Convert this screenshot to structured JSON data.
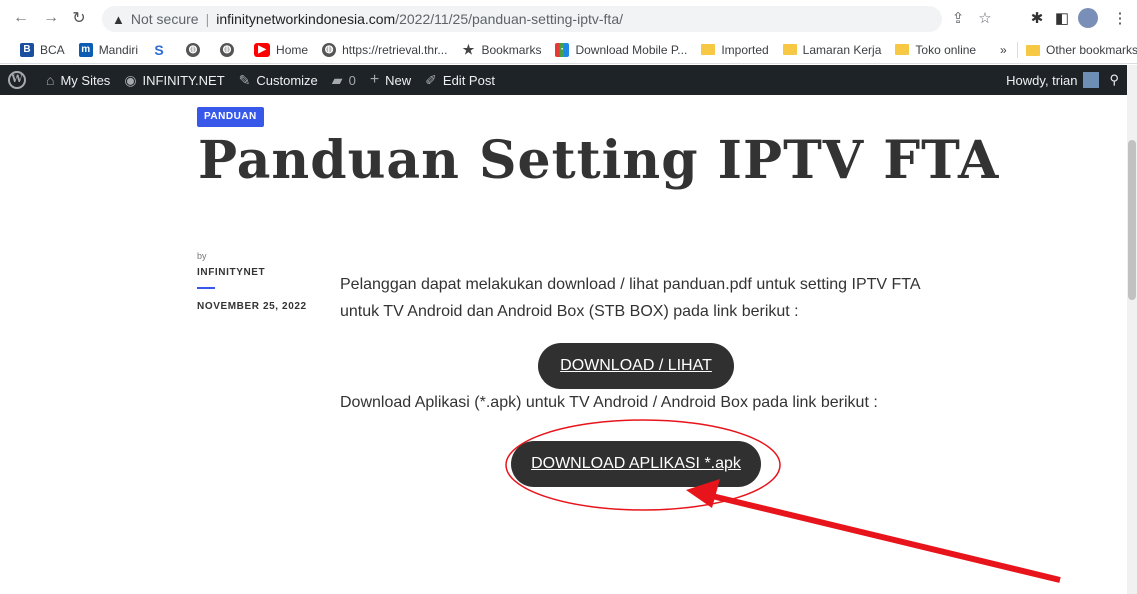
{
  "browser": {
    "security_label": "Not secure",
    "url_domain": "infinitynetworkindonesia.com",
    "url_path": "/2022/11/25/panduan-setting-iptv-fta/"
  },
  "bookmarks": {
    "items": [
      {
        "label": "BCA",
        "icon": "bca-icon",
        "color": "#1a4fa0"
      },
      {
        "label": "Mandiri",
        "icon": "mandiri-icon",
        "color": "#0b5db3"
      },
      {
        "label": "",
        "icon": "s-logo-icon",
        "color": "#2f6cd8"
      },
      {
        "label": "",
        "icon": "globe-icon",
        "color": "#555555"
      },
      {
        "label": "",
        "icon": "globe-icon",
        "color": "#555555"
      },
      {
        "label": "Home",
        "icon": "youtube-icon",
        "color": "#ff0000"
      },
      {
        "label": "https://retrieval.thr...",
        "icon": "globe-icon",
        "color": "#555555"
      },
      {
        "label": "Bookmarks",
        "icon": "star-icon",
        "color": "#444444"
      },
      {
        "label": "Download Mobile P...",
        "icon": "grid-icon",
        "color": "#e53935"
      },
      {
        "label": "Imported",
        "icon": "folder-icon",
        "color": "#f6c844"
      },
      {
        "label": "Lamaran Kerja",
        "icon": "folder-icon",
        "color": "#f6c844"
      },
      {
        "label": "Toko online",
        "icon": "folder-icon",
        "color": "#f6c844"
      }
    ],
    "overflow": "»",
    "other": "Other bookmarks"
  },
  "adminbar": {
    "my_sites": "My Sites",
    "site_name": "INFINITY.NET",
    "customize": "Customize",
    "comments_count": "0",
    "new": "New",
    "edit_post": "Edit Post",
    "howdy": "Howdy, trian"
  },
  "post": {
    "category": "PANDUAN",
    "title": "Panduan Setting IPTV FTA",
    "by": "by",
    "author": "INFINITYNET",
    "date": "NOVEMBER 25, 2022",
    "paragraph1": "Pelanggan dapat melakukan download / lihat panduan.pdf untuk setting IPTV FTA untuk TV Android dan Android Box (STB BOX) pada link berikut :",
    "button1": "DOWNLOAD / LIHAT",
    "paragraph2": "Download Aplikasi (*.apk) untuk TV Android / Android Box pada link berikut :",
    "button2": "DOWNLOAD APLIKASI *.apk"
  },
  "colors": {
    "accent": "#3858e9",
    "button_bg": "#303030",
    "annotation": "#e8141b"
  }
}
